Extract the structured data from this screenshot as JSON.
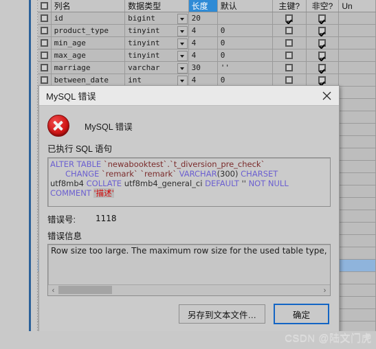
{
  "grid": {
    "columns": [
      "列名",
      "数据类型",
      "长度",
      "默认",
      "主键?",
      "非空?",
      "Un"
    ],
    "selected_column": "长度",
    "rows": [
      {
        "name": "id",
        "type": "bigint",
        "length": "20",
        "default": "",
        "pk": true,
        "nn": true
      },
      {
        "name": "product_type",
        "type": "tinyint",
        "length": "4",
        "default": "0",
        "pk": false,
        "nn": true
      },
      {
        "name": "min_age",
        "type": "tinyint",
        "length": "4",
        "default": "0",
        "pk": false,
        "nn": true
      },
      {
        "name": "max_age",
        "type": "tinyint",
        "length": "4",
        "default": "0",
        "pk": false,
        "nn": true
      },
      {
        "name": "marriage",
        "type": "varchar",
        "length": "30",
        "default": "''",
        "pk": false,
        "nn": true
      },
      {
        "name": "between_date",
        "type": "int",
        "length": "4",
        "default": "0",
        "pk": false,
        "nn": true
      }
    ],
    "hidden_rows_nn": [
      true,
      true,
      true,
      true,
      true,
      true,
      true,
      true,
      true,
      true,
      true,
      true,
      true,
      true,
      true,
      true,
      true,
      true,
      true,
      true
    ],
    "selected_row_index": 20
  },
  "dialog": {
    "title": "MySQL 错误",
    "close_icon": "close-icon",
    "error_icon": "error-circle-icon",
    "heading": "MySQL 错误",
    "sql_label": "已执行 SQL 语句",
    "sql": {
      "line1_kw": "ALTER TABLE",
      "line1_ident": "`newabooktest`.`t_diversion_pre_check`",
      "line2_kw1": "CHANGE",
      "line2_ident": "`remark` `remark`",
      "line2_kw2": "VARCHAR",
      "line2_paren": "(300)",
      "line2_kw3": "CHARSET",
      "line3_val1": "utf8mb4",
      "line3_kw1": "COLLATE",
      "line3_val2": "utf8mb4_general_ci",
      "line3_kw2": "DEFAULT",
      "line3_val3": "''",
      "line3_kw3": "NOT NULL",
      "line4_kw": "COMMENT",
      "line4_hl": "'描述'"
    },
    "errno_label": "错误号:",
    "errno_value": "1118",
    "message_label": "错误信息",
    "message_text": "Row size too large. The maximum row size for the used table type, not",
    "scroll_left_icon": "chevron-left-icon",
    "scroll_right_icon": "chevron-right-icon",
    "buttons": {
      "save": "另存到文本文件…",
      "ok": "确定"
    },
    "accent_color": "#1264c4",
    "error_color": "#cf1414"
  },
  "watermark": "CSDN @陆文门虎"
}
